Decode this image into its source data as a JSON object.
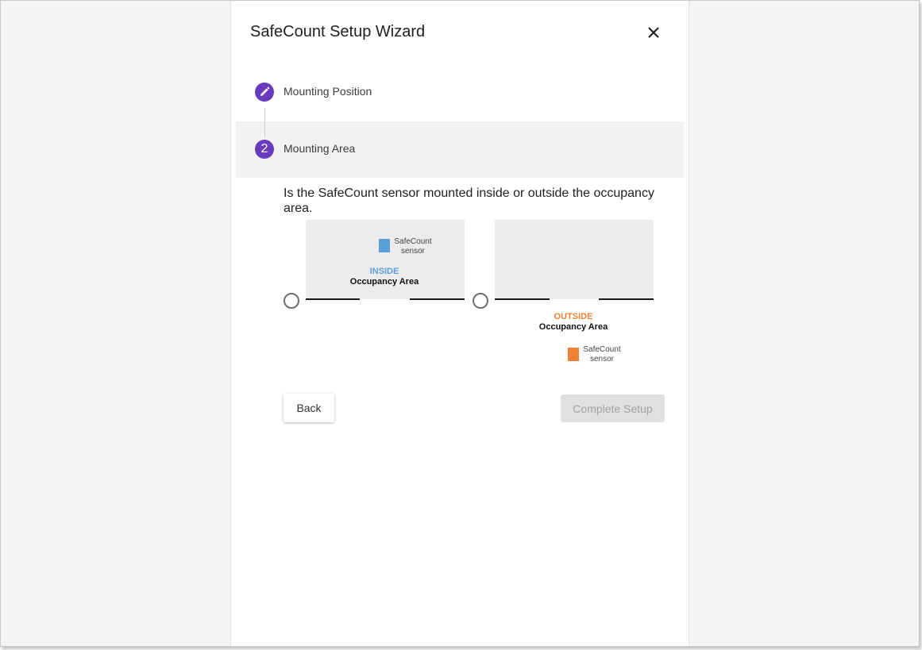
{
  "dialog": {
    "title": "SafeCount Setup Wizard",
    "close_icon": "close-icon"
  },
  "steps": [
    {
      "indicator_icon": "pencil-icon",
      "label": "Mounting Position",
      "state": "completed"
    },
    {
      "indicator_number": "2",
      "label": "Mounting Area",
      "state": "active"
    }
  ],
  "question": "Is the SafeCount sensor mounted inside or outside the occupancy area.",
  "options": [
    {
      "tag": "INSIDE",
      "subtitle": "Occupancy Area",
      "sensor_line1": "SafeCount",
      "sensor_line2": "sensor",
      "tag_color": "#5a9fd8",
      "sensor_color": "#5a9fd8",
      "selected": false
    },
    {
      "tag": "OUTSIDE",
      "subtitle": "Occupancy Area",
      "sensor_line1": "SafeCount",
      "sensor_line2": "sensor",
      "tag_color": "#ee8133",
      "sensor_color": "#ee8133",
      "selected": false
    }
  ],
  "buttons": {
    "back_label": "Back",
    "complete_label": "Complete Setup",
    "complete_disabled": true
  },
  "colors": {
    "accent": "#6a3bbd",
    "active_step_bg": "#f2f2f2"
  }
}
